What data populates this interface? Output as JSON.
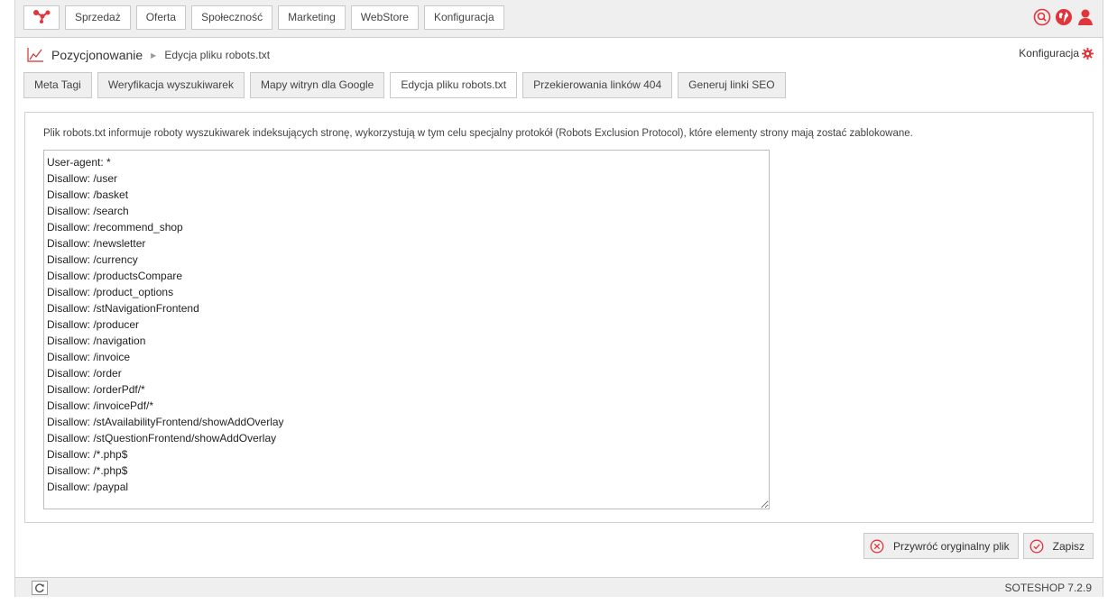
{
  "topnav": {
    "logo_icon": "molecule-logo-icon",
    "items": [
      "Sprzedaż",
      "Oferta",
      "Społeczność",
      "Marketing",
      "WebStore",
      "Konfiguracja"
    ],
    "right_icons": [
      "search-icon",
      "globe-icon",
      "user-icon"
    ]
  },
  "breadcrumb": {
    "icon": "chart-icon",
    "section": "Pozycjonowanie",
    "page": "Edycja pliku robots.txt"
  },
  "config_link": {
    "label": "Konfiguracja",
    "icon": "gear-icon"
  },
  "tabs": [
    {
      "label": "Meta Tagi",
      "active": false
    },
    {
      "label": "Weryfikacja wyszukiwarek",
      "active": false
    },
    {
      "label": "Mapy witryn dla Google",
      "active": false
    },
    {
      "label": "Edycja pliku robots.txt",
      "active": true
    },
    {
      "label": "Przekierowania linków 404",
      "active": false
    },
    {
      "label": "Generuj linki SEO",
      "active": false
    }
  ],
  "content": {
    "info": "Plik robots.txt informuje roboty wyszukiwarek indeksujących stronę, wykorzystują w tym celu specjalny protokół (Robots Exclusion Protocol), które elementy strony mają zostać zablokowane.",
    "robots_txt": "User-agent: *\nDisallow: /user\nDisallow: /basket\nDisallow: /search\nDisallow: /recommend_shop\nDisallow: /newsletter\nDisallow: /currency\nDisallow: /productsCompare\nDisallow: /product_options\nDisallow: /stNavigationFrontend\nDisallow: /producer\nDisallow: /navigation\nDisallow: /invoice\nDisallow: /order\nDisallow: /orderPdf/*\nDisallow: /invoicePdf/*\nDisallow: /stAvailabilityFrontend/showAddOverlay\nDisallow: /stQuestionFrontend/showAddOverlay\nDisallow: /*.php$\nDisallow: /*.php$\nDisallow: /paypal"
  },
  "actions": {
    "restore_label": "Przywróć oryginalny plik",
    "save_label": "Zapisz"
  },
  "footer": {
    "refresh_icon": "refresh-icon",
    "version": "SOTESHOP 7.2.9"
  },
  "colors": {
    "accent": "#e0353a",
    "panel_border": "#d0d0d0",
    "bar_bg": "#efefef"
  }
}
